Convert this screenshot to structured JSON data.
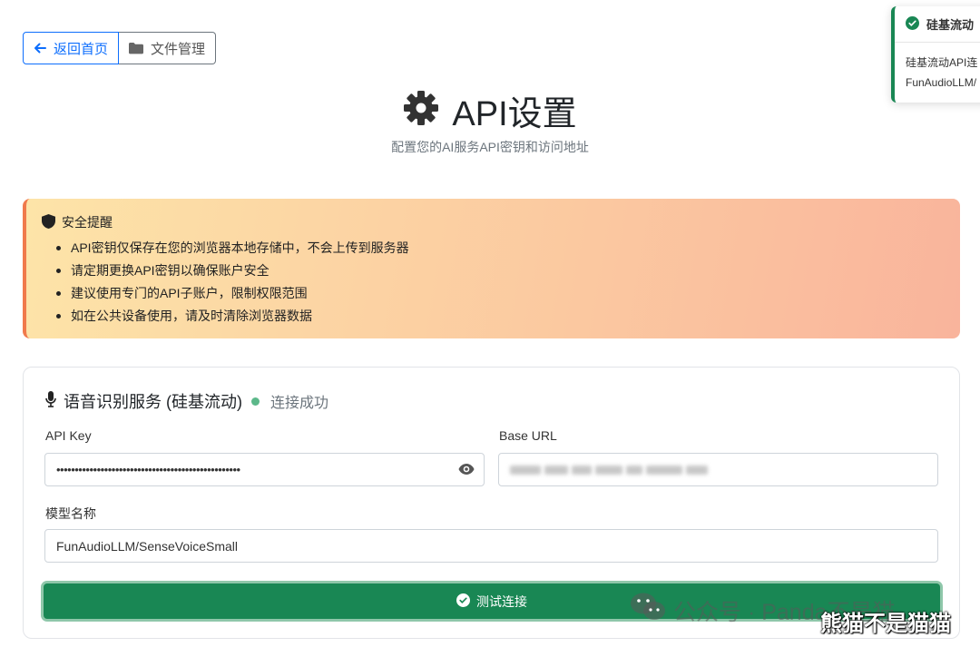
{
  "nav": {
    "back_label": "返回首页",
    "files_label": "文件管理"
  },
  "header": {
    "title": "API设置",
    "subtitle": "配置您的AI服务API密钥和访问地址"
  },
  "toast": {
    "title": "硅基流动",
    "line1": "硅基流动API连",
    "line2": "FunAudioLLM/"
  },
  "alert": {
    "title": "安全提醒",
    "items": [
      "API密钥仅保存在您的浏览器本地存储中，不会上传到服务器",
      "请定期更换API密钥以确保账户安全",
      "建议使用专门的API子账户，限制权限范围",
      "如在公共设备使用，请及时清除浏览器数据"
    ]
  },
  "speech_service": {
    "title": "语音识别服务 (硅基流动)",
    "status": "连接成功",
    "api_key_label": "API Key",
    "api_key_value": "••••••••••••••••••••••••••••••••••••••••••••••••••",
    "base_url_label": "Base URL",
    "model_label": "模型名称",
    "model_value": "FunAudioLLM/SenseVoiceSmall",
    "test_button": "测试连接"
  },
  "watermark": {
    "wechat": "公众号 · Panda不是猫",
    "overlay": "熊猫不是猫猫"
  },
  "colors": {
    "primary": "#0d6efd",
    "success": "#198754",
    "warning_border": "#f07a4c"
  },
  "icons": [
    "arrow-left-icon",
    "folder-icon",
    "gear-icon",
    "check-circle-icon",
    "shield-icon",
    "microphone-icon",
    "eye-icon",
    "wechat-icon"
  ]
}
